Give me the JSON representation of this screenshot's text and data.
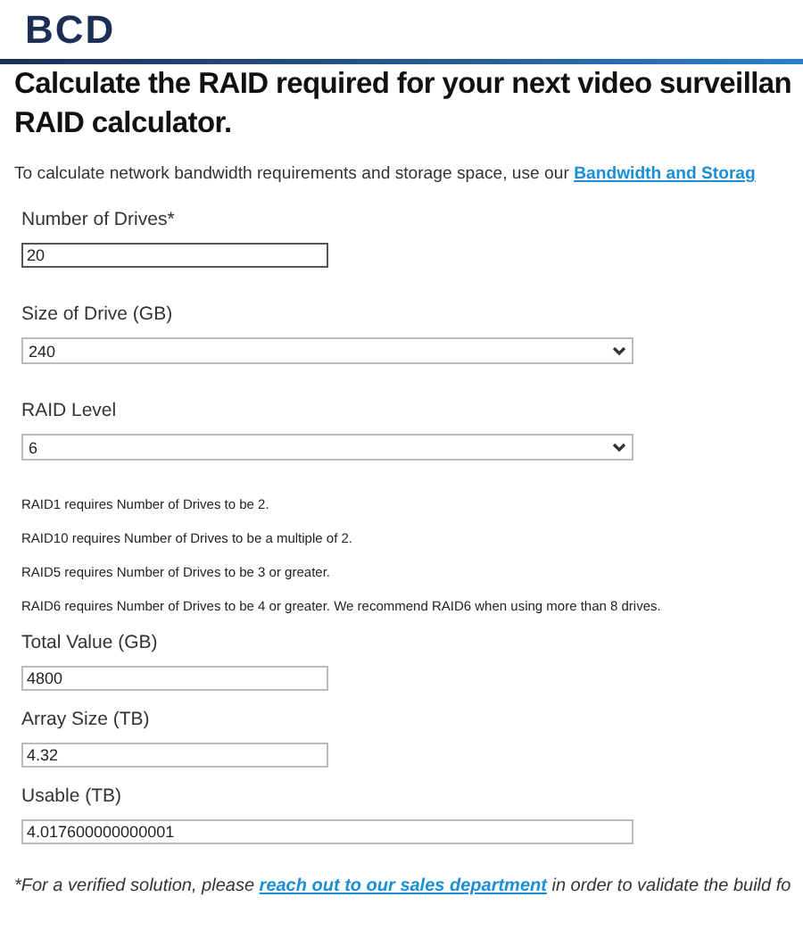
{
  "logo": "BCD",
  "heading": "Calculate the RAID required for your next video surveillan",
  "heading_line_2": "RAID calculator.",
  "intro": {
    "text": "To calculate network bandwidth requirements and storage space, use our ",
    "link": "Bandwidth and Storag"
  },
  "inputs": [
    {
      "kind": "short",
      "label": "Number of Drives*",
      "value": "20"
    },
    {
      "kind": "select",
      "label": "Size of Drive (GB)",
      "value": "240"
    },
    {
      "kind": "select",
      "label": "RAID Level",
      "value": "6"
    }
  ],
  "notes": [
    "RAID1 requires Number of Drives to be 2.",
    "RAID10 requires Number of Drives to be a multiple of 2.",
    "RAID5 requires Number of Drives to be 3 or greater.",
    "RAID6 requires Number of Drives to be 4 or greater. We recommend RAID6 when using more than 8 drives."
  ],
  "results": [
    {
      "kind": "short",
      "label": "Total Value (GB)",
      "value": "4800"
    },
    {
      "kind": "short",
      "label": "Array Size (TB)",
      "value": "4.32"
    },
    {
      "kind": "long",
      "label": "Usable (TB)",
      "value": "4.017600000000001"
    }
  ],
  "footer": {
    "before": "*For a verified solution, please ",
    "link": "reach out to our sales department",
    "after": " in order to validate the build fo"
  }
}
